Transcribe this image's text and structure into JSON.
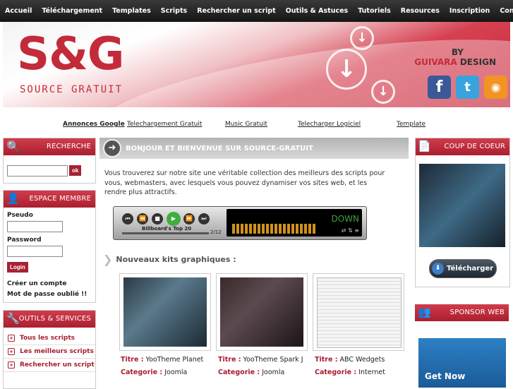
{
  "nav": [
    "Accueil",
    "Téléchargement",
    "Templates",
    "Scripts",
    "Rechercher un script",
    "Outils & Astuces",
    "Tutoriels",
    "Resources",
    "Inscription",
    "Contact"
  ],
  "banner": {
    "logo": "S&G",
    "subtitle": "SOURCE GRATUIT",
    "by": "BY",
    "design_red": "GUIVARA",
    "design": " DESIGN"
  },
  "ads": {
    "label": "Annonces Google",
    "links": [
      "Telechargement Gratuit",
      "Music Gratuit",
      "Telecharger Logiciel",
      "Template"
    ]
  },
  "search": {
    "title": "Recherche",
    "button": "ok",
    "value": ""
  },
  "member": {
    "title": "Espace membre",
    "pseudo_label": "Pseudo",
    "password_label": "Password",
    "login": "Login",
    "create": "Créer un compte",
    "forgot": "Mot de passe oublié !!"
  },
  "tools": {
    "title": "Outils & services",
    "items": [
      "Tous les scripts",
      "Les meilleurs scripts",
      "Rechercher un script"
    ]
  },
  "main": {
    "title": "BONJOUR ET BIENVENUE SUR SOURCE-GRATUIT",
    "intro": "Vous trouverez sur notre site une véritable collection des meilleurs des scripts pour vous, webmasters, avec lesquels vous pouvez dynamiser vos sites web, et les rendre plus attractifs.",
    "player": {
      "track": "Billboard's Top 20",
      "counter": "2/12",
      "lcd": "DOWN"
    },
    "kits_title": "Nouveaux kits graphiques :",
    "kits": [
      {
        "title_label": "Titre :",
        "title": "YooTheme Planet",
        "cat_label": "Categorie :",
        "cat": "Joomla"
      },
      {
        "title_label": "Titre :",
        "title": "YooTheme Spark J",
        "cat_label": "Categorie :",
        "cat": "Joomla"
      },
      {
        "title_label": "Titre :",
        "title": "ABC Wedgets",
        "cat_label": "Categorie :",
        "cat": "Internet"
      }
    ]
  },
  "right": {
    "coup_title": "Coup de coeur",
    "download": "Télécharger",
    "sponsor_title": "Sponsor web",
    "get_now": "Get Now"
  },
  "colors": {
    "accent": "#a61d2e",
    "banner": "#c32b3a"
  }
}
